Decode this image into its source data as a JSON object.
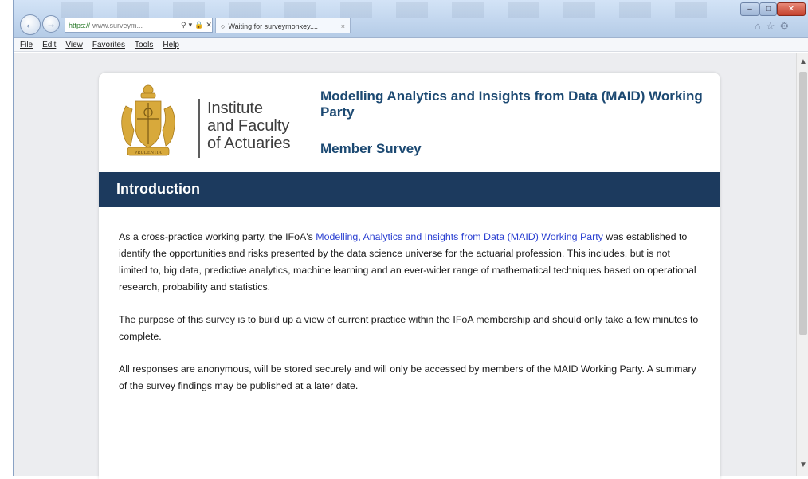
{
  "browser": {
    "address_url": "https://www.surveym...",
    "address_proto": "https://",
    "address_host": "www.surveym...",
    "address_search_icon": "search-icon",
    "tab_title": "Waiting for surveymonkey....",
    "tab_close": "×",
    "menu": [
      "File",
      "Edit",
      "View",
      "Favorites",
      "Tools",
      "Help"
    ]
  },
  "header": {
    "org_line1": "Institute",
    "org_line2": "and Faculty",
    "org_line3": "of Actuaries",
    "crest_motto": "PRUDENTIA",
    "title": "Modelling Analytics and Insights from Data (MAID) Working Party",
    "subtitle": "Member Survey"
  },
  "section": {
    "heading": "Introduction"
  },
  "intro": {
    "p1_before": "As a cross-practice working party, the IFoA's ",
    "p1_link": "Modelling, Analytics and Insights from Data (MAID) Working Party",
    "p1_after": " was established to identify the opportunities and risks presented by the data science universe for the actuarial profession.  This includes, but is not limited to, big data, predictive analytics, machine learning and an ever-wider range of mathematical techniques based on operational research, probability and statistics.",
    "p2": "The purpose of this survey is to build up a view of current practice within the IFoA membership and should only take a few minutes to complete.",
    "p3": "All responses are anonymous, will be stored securely and will only be accessed by members of the MAID Working Party.  A summary of the survey findings may be published at a later date."
  },
  "colors": {
    "brand_navy": "#1c3a5e",
    "title_blue": "#1c4972",
    "link_blue": "#2a3fd1",
    "crest_gold": "#d8a93b"
  }
}
